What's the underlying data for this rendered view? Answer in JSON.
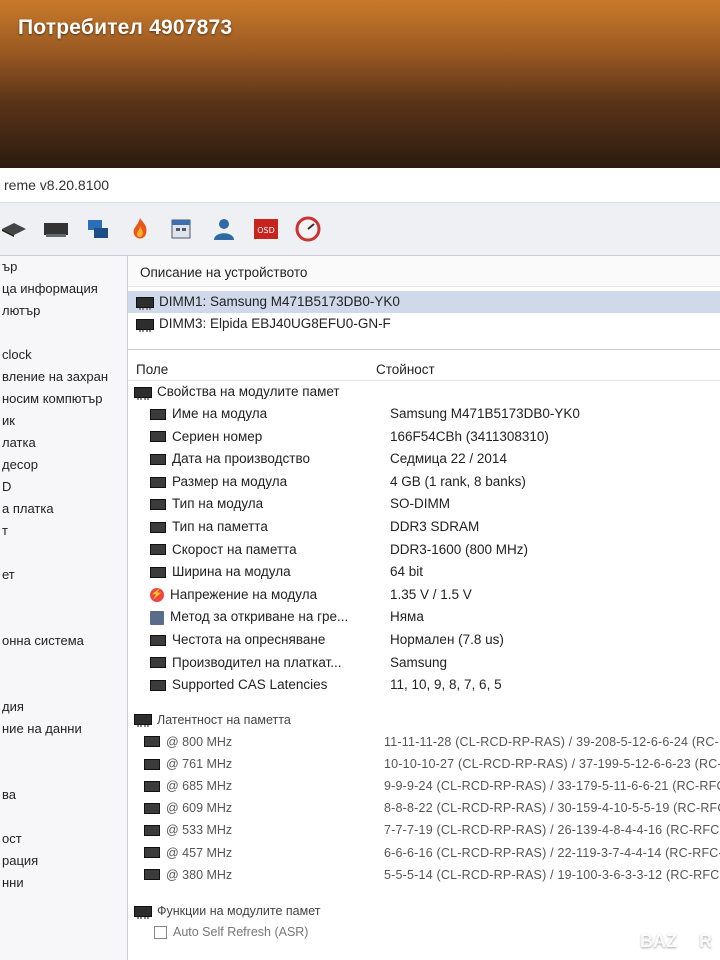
{
  "watermark": {
    "user_label": "Потребител 4907873",
    "brand": "BAZAR"
  },
  "window": {
    "title": "reme v8.20.8100"
  },
  "toolbar": {
    "icons": [
      "memory-icon",
      "motherboard-icon",
      "network-icon",
      "fire-icon",
      "calendar-icon",
      "users-icon",
      "osd-icon",
      "gauge-icon"
    ]
  },
  "left_nav": {
    "items": [
      "ър",
      "ца информация",
      "лютър",
      "",
      "clock",
      "вление на захран",
      "носим компютър",
      "ик",
      "латка",
      "десор",
      "D",
      "а платка",
      "т",
      "",
      "ет",
      "",
      "",
      "онна система",
      "",
      "",
      "дия",
      "ние на данни",
      "",
      "",
      "ва",
      "",
      "ост",
      "рация",
      "нни"
    ]
  },
  "device_panel": {
    "header": "Описание на устройството",
    "devices": [
      {
        "label": "DIMM1: Samsung M471B5173DB0-YK0",
        "selected": true
      },
      {
        "label": "DIMM3: Elpida EBJ40UG8EFU0-GN-F",
        "selected": false
      }
    ]
  },
  "columns": {
    "field": "Поле",
    "value": "Стойност"
  },
  "module_props": {
    "section": "Свойства на модулите памет",
    "rows": [
      {
        "field": "Име на модула",
        "value": "Samsung M471B5173DB0-YK0",
        "icon": "memory-icon"
      },
      {
        "field": "Сериен номер",
        "value": "166F54CBh (3411308310)",
        "icon": "memory-icon"
      },
      {
        "field": "Дата на производство",
        "value": "Седмица 22 / 2014",
        "icon": "memory-icon"
      },
      {
        "field": "Размер на модула",
        "value": "4 GB (1 rank, 8 banks)",
        "icon": "memory-icon"
      },
      {
        "field": "Тип на модула",
        "value": "SO-DIMM",
        "icon": "memory-icon"
      },
      {
        "field": "Тип на паметта",
        "value": "DDR3 SDRAM",
        "icon": "memory-icon"
      },
      {
        "field": "Скорост на паметта",
        "value": "DDR3-1600 (800 MHz)",
        "icon": "memory-icon"
      },
      {
        "field": "Ширина на модула",
        "value": "64 bit",
        "icon": "memory-icon"
      },
      {
        "field": "Напрежение на модула",
        "value": "1.35 V / 1.5 V",
        "icon": "voltage-icon"
      },
      {
        "field": "Метод за откриване на гре...",
        "value": "Няма",
        "icon": "document-icon"
      },
      {
        "field": "Честота на опресняване",
        "value": "Нормален (7.8 us)",
        "icon": "memory-icon"
      },
      {
        "field": "Производител на платкат...",
        "value": "Samsung",
        "icon": "memory-icon"
      },
      {
        "field": "Supported CAS Latencies",
        "value": "11, 10, 9, 8, 7, 6, 5",
        "icon": "memory-icon"
      }
    ]
  },
  "latency": {
    "section": "Латентност на паметта",
    "rows": [
      {
        "freq": "@ 800 MHz",
        "value": "11-11-11-28  (CL-RCD-RP-RAS) / 39-208-5-12-6-6-24  (RC-"
      },
      {
        "freq": "@ 761 MHz",
        "value": "10-10-10-27  (CL-RCD-RP-RAS) / 37-199-5-12-6-6-23  (RC-"
      },
      {
        "freq": "@ 685 MHz",
        "value": "9-9-9-24  (CL-RCD-RP-RAS) / 33-179-5-11-6-6-21  (RC-RFC"
      },
      {
        "freq": "@ 609 MHz",
        "value": "8-8-8-22  (CL-RCD-RP-RAS) / 30-159-4-10-5-5-19  (RC-RFC"
      },
      {
        "freq": "@ 533 MHz",
        "value": "7-7-7-19  (CL-RCD-RP-RAS) / 26-139-4-8-4-4-16  (RC-RFC-"
      },
      {
        "freq": "@ 457 MHz",
        "value": "6-6-6-16  (CL-RCD-RP-RAS) / 22-119-3-7-4-4-14  (RC-RFC-"
      },
      {
        "freq": "@ 380 MHz",
        "value": "5-5-5-14  (CL-RCD-RP-RAS) / 19-100-3-6-3-3-12  (RC-RFC-"
      }
    ]
  },
  "features": {
    "section": "Функции на модулите памет",
    "first_item": "Auto Self Refresh (ASR)"
  }
}
